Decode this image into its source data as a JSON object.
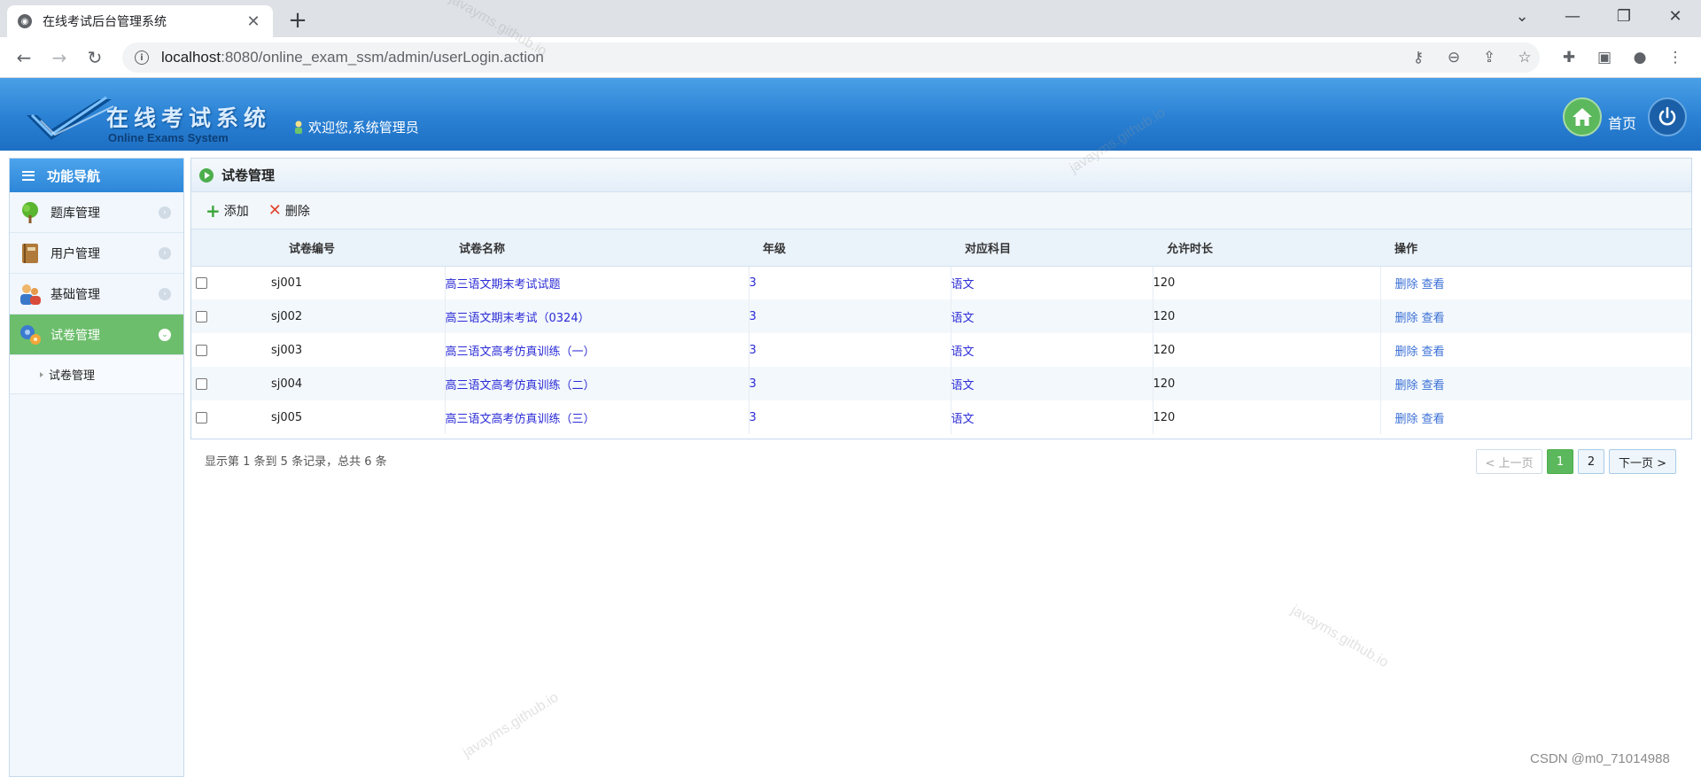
{
  "browser": {
    "tab_title": "在线考试后台管理系统",
    "tab_close": "✕",
    "new_tab": "+",
    "url_host": "localhost",
    "url_rest": ":8080/online_exam_ssm/admin/userLogin.action",
    "window_controls": [
      "⌄",
      "—",
      "❐",
      "✕"
    ]
  },
  "header": {
    "logo_cn": "在线考试系统",
    "logo_en": "Online Exams System",
    "welcome": "欢迎您,系统管理员",
    "home_label": "首页"
  },
  "sidebar": {
    "title": "功能导航",
    "items": [
      {
        "label": "题库管理",
        "icon": "tree-icon"
      },
      {
        "label": "用户管理",
        "icon": "book-icon"
      },
      {
        "label": "基础管理",
        "icon": "users-icon"
      },
      {
        "label": "试卷管理",
        "icon": "gear-icon"
      }
    ],
    "sub_items": [
      "试卷管理"
    ]
  },
  "panel": {
    "title": "试卷管理",
    "actions": {
      "add": "添加",
      "delete": "删除"
    },
    "columns": [
      "试卷编号",
      "试卷名称",
      "年级",
      "对应科目",
      "允许时长",
      "操作"
    ],
    "rows": [
      {
        "id": "sj001",
        "name": "高三语文期末考试试题",
        "grade": "3",
        "subject": "语文",
        "duration": "120"
      },
      {
        "id": "sj002",
        "name": "高三语文期末考试（0324）",
        "grade": "3",
        "subject": "语文",
        "duration": "120"
      },
      {
        "id": "sj003",
        "name": "高三语文高考仿真训练（一）",
        "grade": "3",
        "subject": "语文",
        "duration": "120"
      },
      {
        "id": "sj004",
        "name": "高三语文高考仿真训练（二）",
        "grade": "3",
        "subject": "语文",
        "duration": "120"
      },
      {
        "id": "sj005",
        "name": "高三语文高考仿真训练（三）",
        "grade": "3",
        "subject": "语文",
        "duration": "120"
      }
    ],
    "row_ops": {
      "delete": "删除",
      "view": "查看"
    },
    "summary": "显示第 1 条到 5 条记录，总共 6 条",
    "pager": {
      "prev": "< 上一页",
      "pages": [
        "1",
        "2"
      ],
      "current": "1",
      "next": "下一页 >"
    }
  },
  "watermark": "javayms.github.io",
  "credit": "CSDN @m0_71014988",
  "colors": {
    "header_blue": "#2a81d4",
    "active_green": "#6cbe6c",
    "link_blue": "#2b2bd6"
  }
}
